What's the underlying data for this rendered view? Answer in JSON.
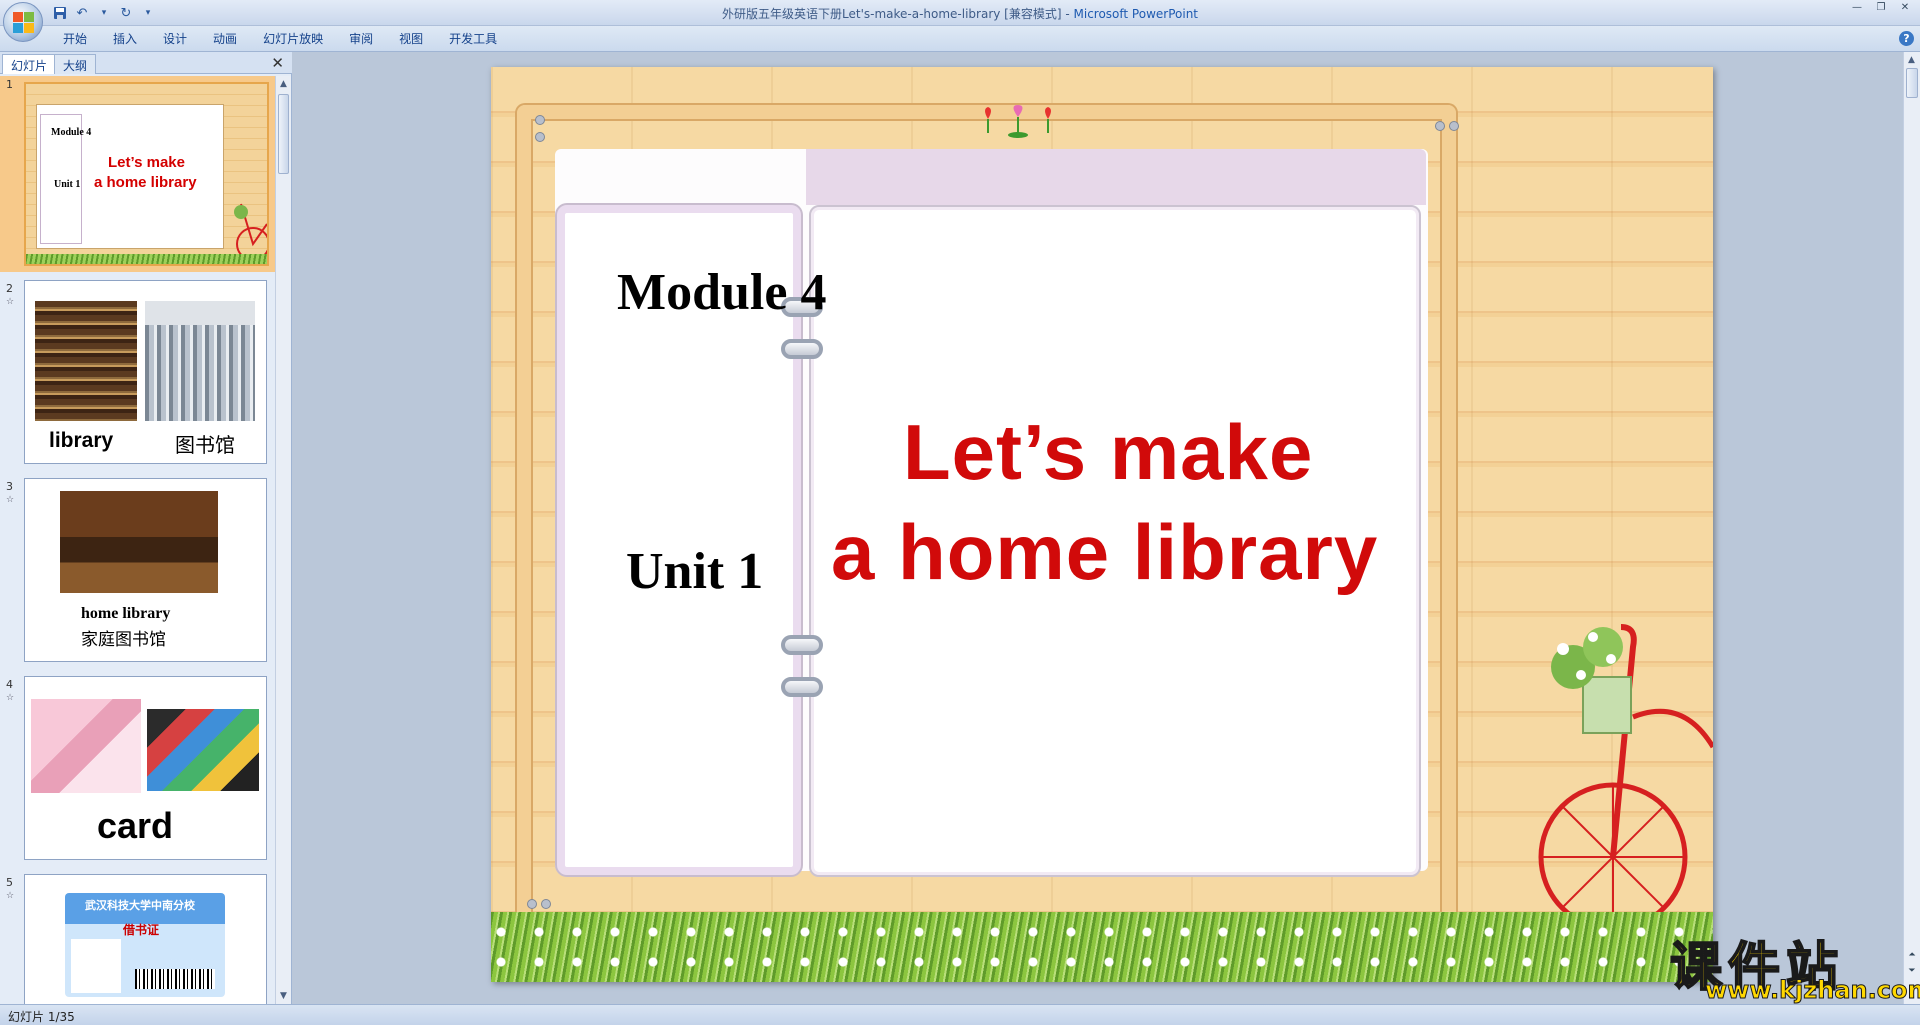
{
  "titlebar": {
    "title": "外研版五年级英语下册Let's-make-a-home-library [兼容模式] - ",
    "app_name": "Microsoft PowerPoint"
  },
  "ribbon": {
    "tabs": [
      "开始",
      "插入",
      "设计",
      "动画",
      "幻灯片放映",
      "审阅",
      "视图",
      "开发工具"
    ]
  },
  "panel": {
    "tab_slides": "幻灯片",
    "tab_outline": "大纲",
    "close_glyph": "✕"
  },
  "thumbnails": [
    {
      "num": "1",
      "module": "Module 4",
      "unit": "Unit 1",
      "line1": "Let’s make",
      "line2": "a home library"
    },
    {
      "num": "2",
      "cap_en": "library",
      "cap_cn": "图书馆"
    },
    {
      "num": "3",
      "cap_en": "home library",
      "cap_cn": "家庭图书馆"
    },
    {
      "num": "4",
      "cap_en": "card"
    },
    {
      "num": "5",
      "card_title": "武汉科技大学中南分校",
      "card_sub": "借书证"
    }
  ],
  "slide": {
    "module": "Module 4",
    "unit": "Unit 1",
    "title_line1": "Let’s make",
    "title_line2": "a home library"
  },
  "watermark": {
    "cn": "课件站",
    "url": "www.kjzhan.com"
  },
  "status": {
    "slide_counter": "幻灯片 1/35"
  },
  "colors": {
    "title_red": "#d10a0a",
    "wood": "#f6d9a3",
    "ribbon_text": "#15428b"
  }
}
